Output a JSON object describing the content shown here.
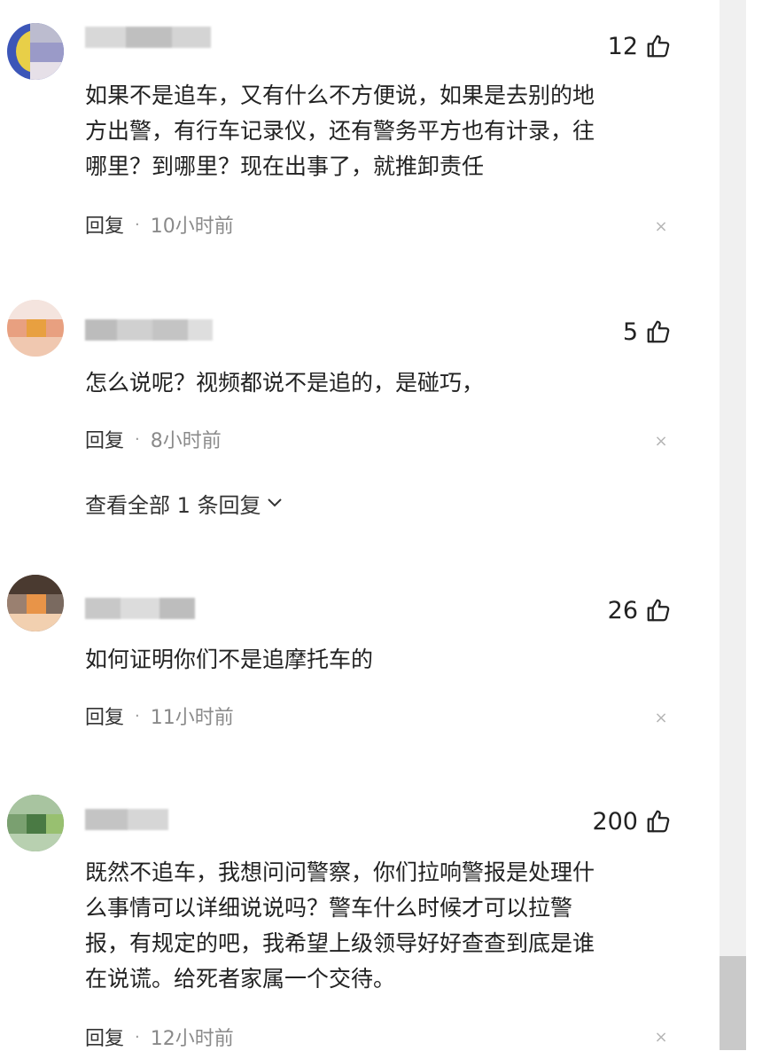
{
  "comments": [
    {
      "username": "",
      "likes": "12",
      "text": "如果不是追车，又有什么不方便说，如果是去别的地\n方出警，有行车记录仪，还有警务平方也有计录，往\n哪里？到哪里？现在出事了，就推卸责任",
      "reply_label": "回复",
      "separator": "·",
      "time": "10小时前",
      "close_glyph": "×"
    },
    {
      "username": "",
      "likes": "5",
      "text": "怎么说呢？视频都说不是追的，是碰巧，",
      "reply_label": "回复",
      "separator": "·",
      "time": "8小时前",
      "close_glyph": "×",
      "view_replies": "查看全部 1 条回复"
    },
    {
      "username": "",
      "likes": "26",
      "text": "如何证明你们不是追摩托车的",
      "reply_label": "回复",
      "separator": "·",
      "time": "11小时前",
      "close_glyph": "×"
    },
    {
      "username": "",
      "likes": "200",
      "text": "既然不追车，我想问问警察，你们拉响警报是处理什\n么事情可以详细说说吗？警车什么时候才可以拉警\n报，有规定的吧，我希望上级领导好好查查到底是谁\n在说谎。给死者家属一个交待。",
      "reply_label": "回复",
      "separator": "·",
      "time": "12小时前",
      "close_glyph": "×"
    }
  ],
  "icons": {
    "like": "thumbs-up-icon",
    "close": "close-icon",
    "expand": "chevron-down-icon"
  },
  "colors": {
    "text": "#222222",
    "meta": "#8a8a8a",
    "scrollbar_track": "#f0f0f0",
    "scrollbar_thumb": "#c9c9c9"
  }
}
